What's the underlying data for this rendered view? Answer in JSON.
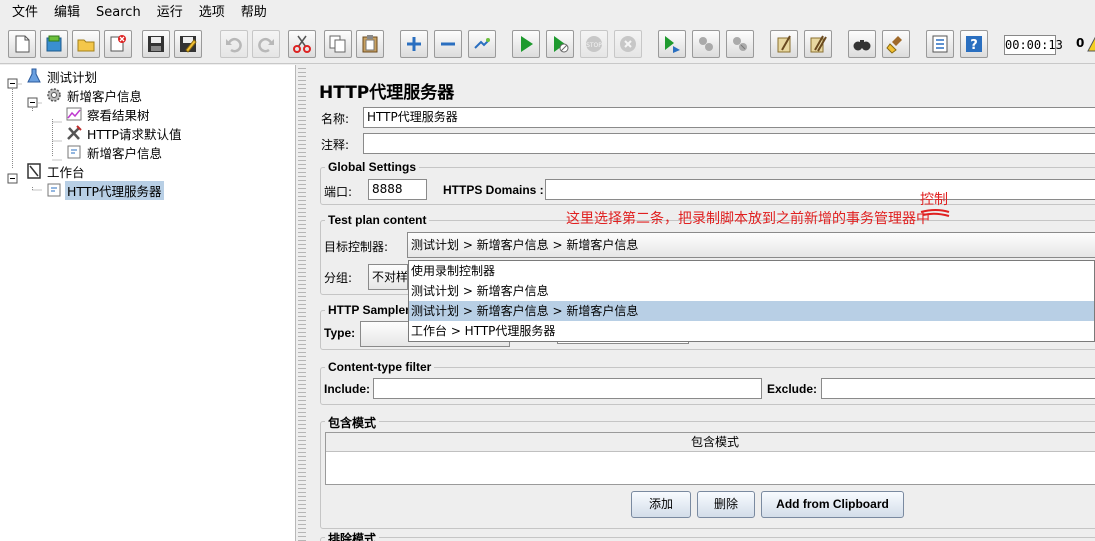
{
  "menu": [
    "文件",
    "编辑",
    "Search",
    "运行",
    "选项",
    "帮助"
  ],
  "toolbar": {
    "icons": [
      "new-icon",
      "templates-icon",
      "open-icon",
      "close-icon",
      "save-icon",
      "save-as-icon",
      "undo-icon",
      "redo-icon",
      "cut-icon",
      "copy-icon",
      "paste-icon",
      "expand-icon",
      "collapse-icon",
      "toggle-icon",
      "start-icon",
      "start-no-pause-icon",
      "stop-icon",
      "shutdown-icon",
      "remote-start-icon",
      "remote-stop-icon",
      "remote-exit-icon",
      "clear-icon",
      "clear-all-icon",
      "search-icon",
      "reset-search-icon",
      "function-helper-icon",
      "help-icon"
    ],
    "timer": "00:00:13",
    "error_count": "0"
  },
  "tree": {
    "items": [
      "测试计划",
      "新增客户信息",
      "察看结果树",
      "HTTP请求默认值",
      "新增客户信息",
      "工作台",
      "HTTP代理服务器"
    ],
    "selected_index": 6
  },
  "panel": {
    "title": "HTTP代理服务器",
    "name_label": "名称:",
    "name_value": "HTTP代理服务器",
    "comment_label": "注释:",
    "comment_value": "",
    "global": {
      "title": "Global Settings",
      "port_label": "端口:",
      "port_value": "8888",
      "https_label": "HTTPS Domains :",
      "https_value": ""
    },
    "test_plan": {
      "title": "Test plan content",
      "target_label": "目标控制器:",
      "target_value": "测试计划 > 新增客户信息 > 新增客户信息",
      "group_label": "分组:",
      "group_value": "不对样",
      "options": [
        "使用录制控制器",
        "测试计划 > 新增客户信息",
        "测试计划 > 新增客户信息 > 新增客户信息",
        "工作台 > HTTP代理服务器"
      ],
      "selected_option": 2
    },
    "sampler": {
      "title": "HTTP Sampler",
      "type_label": "Type:"
    },
    "content_type": {
      "title": "Content-type filter",
      "include_label": "Include:",
      "include_value": "",
      "exclude_label": "Exclude:",
      "exclude_value": ""
    },
    "include_pattern": {
      "title": "包含模式",
      "column_header": "包含模式",
      "add_label": "添加",
      "delete_label": "删除",
      "clipboard_label": "Add from Clipboard"
    },
    "exclude_pattern": {
      "title": "排除模式"
    }
  },
  "annotation": {
    "line1": "控制",
    "line2": "这里选择第二条，把录制脚本放到之前新增的事务管理器中",
    "color": "#e02020"
  }
}
